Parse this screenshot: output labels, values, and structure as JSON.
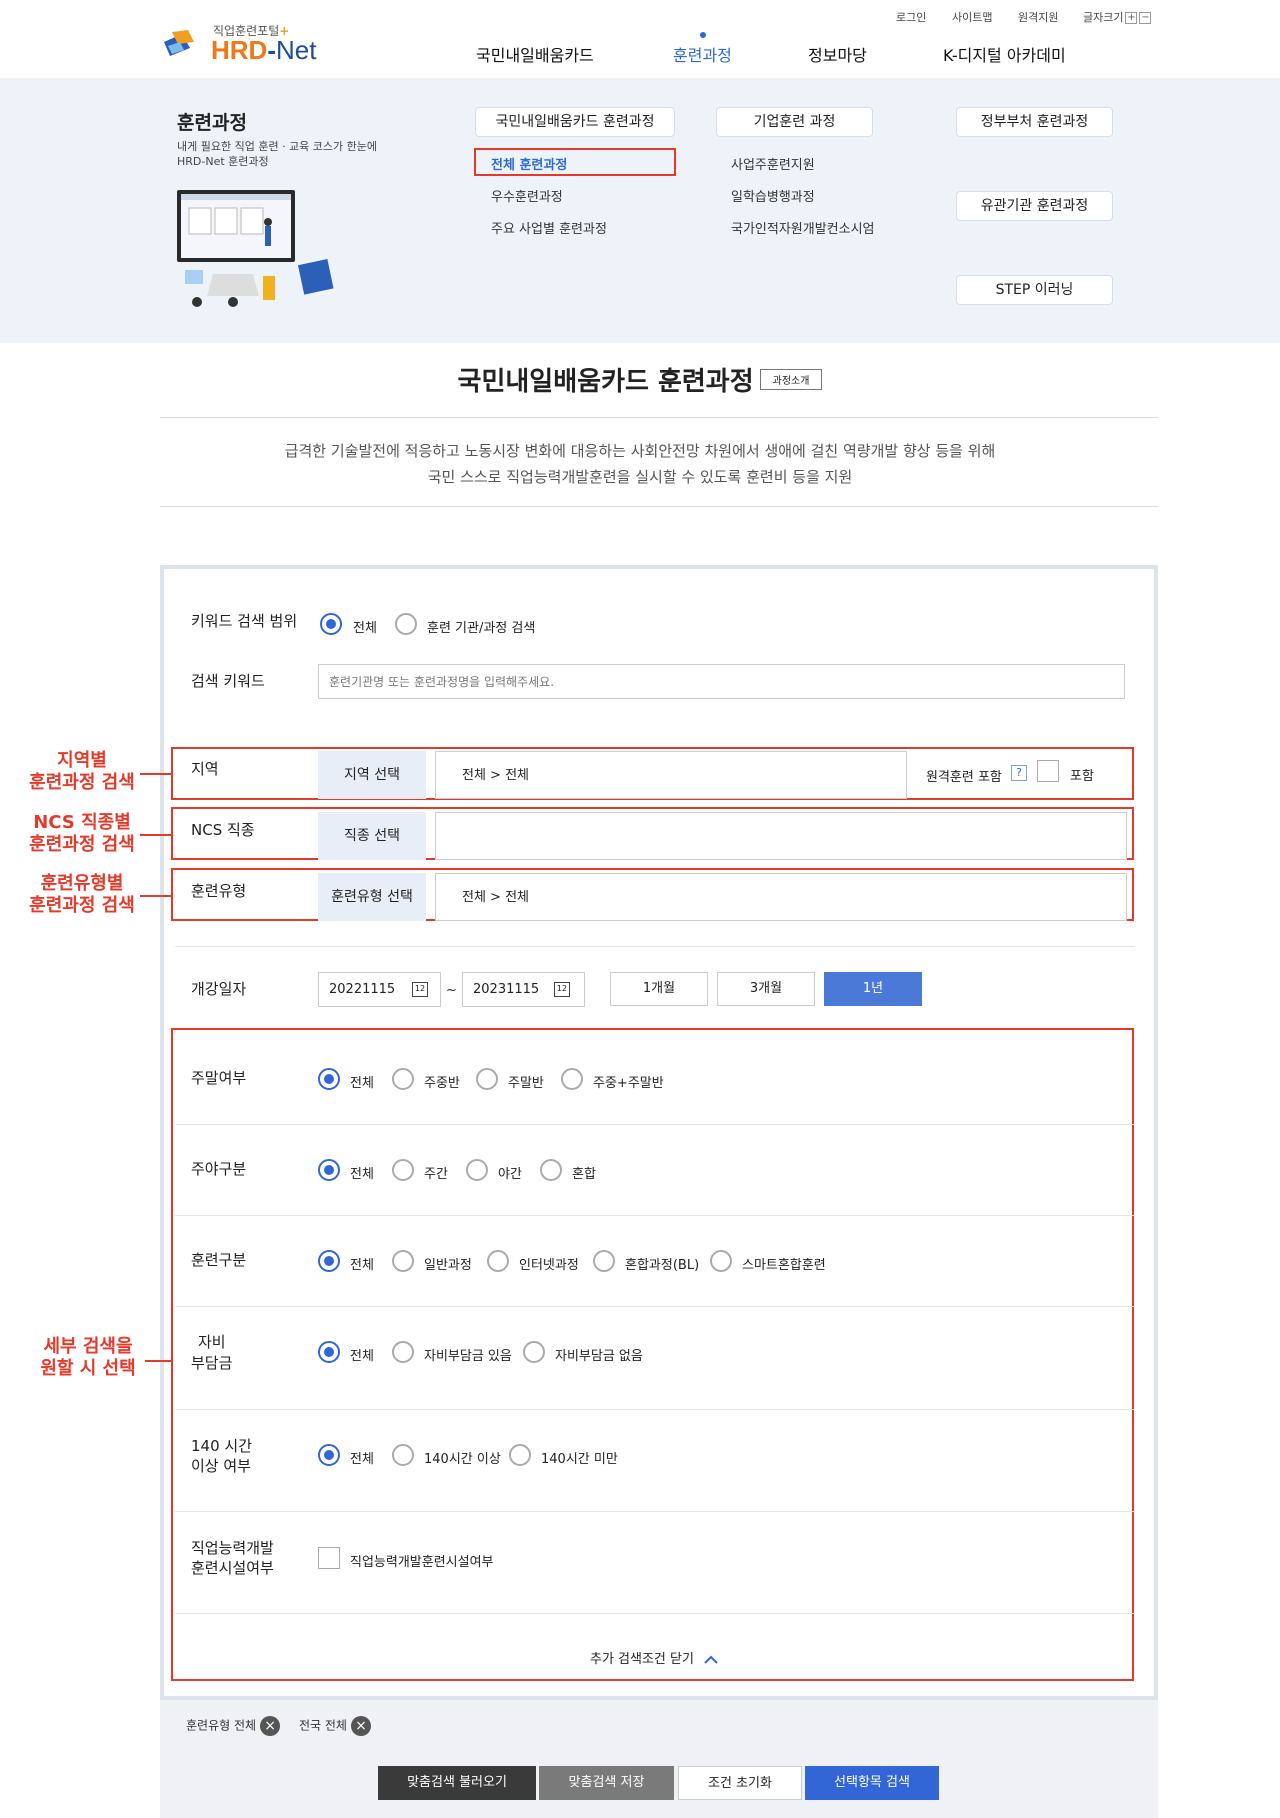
{
  "header": {
    "util": [
      "로그인",
      "사이트맵",
      "원격지원",
      "글자크기"
    ],
    "font_plus": "+",
    "font_minus": "−",
    "logo_sub": "직업훈련포털",
    "logo_plus": "+",
    "logo_hrd": "HRD",
    "logo_dash": "-",
    "logo_net": "Net",
    "gnb": [
      "국민내일배움카드",
      "훈련과정",
      "정보마당",
      "K-디지털 아카데미"
    ]
  },
  "mega": {
    "title": "훈련과정",
    "desc": "내게 필요한 직업 훈련 · 교육 코스가 한눈에 HRD-Net 훈련과정",
    "pills": [
      "국민내일배움카드 훈련과정",
      "기업훈련 과정",
      "정부부처 훈련과정",
      "유관기관 훈련과정",
      "STEP 이러닝"
    ],
    "col1": [
      "전체 훈련과정",
      "우수훈련과정",
      "주요 사업별 훈련과정"
    ],
    "col2": [
      "사업주훈련지원",
      "일학습병행과정",
      "국가인적자원개발컨소시엄"
    ]
  },
  "page": {
    "title": "국민내일배움카드 훈련과정",
    "intro_btn": "과정소개",
    "lead1": "급격한 기술발전에 적응하고 노동시장 변화에 대응하는 사회안전망 차원에서 생애에 걸친 역량개발 향상 등을 위해",
    "lead2": "국민 스스로 직업능력개발훈련을 실시할 수 있도록 훈련비 등을 지원"
  },
  "search": {
    "scope_label": "키워드 검색 범위",
    "scope_opts": [
      "전체",
      "훈련 기관/과정 검색"
    ],
    "keyword_label": "검색 키워드",
    "keyword_placeholder": "훈련기관명 또는 훈련과정명을 입력해주세요.",
    "region_label": "지역",
    "region_btn": "지역 선택",
    "region_value": "전체 > 전체",
    "remote_label": "원격훈련 포함",
    "remote_q": "?",
    "remote_include": "포함",
    "ncs_label": "NCS 직종",
    "ncs_btn": "직종 선택",
    "ncs_value": "",
    "type_label": "훈련유형",
    "type_btn": "훈련유형 선택",
    "type_value": "전체 > 전체",
    "date_label": "개강일자",
    "date_from": "20221115",
    "date_to": "20231115",
    "date_tilde": "~",
    "cal_icon": "12",
    "periods": [
      "1개월",
      "3개월",
      "1년"
    ],
    "weekend_label": "주말여부",
    "weekend_opts": [
      "전체",
      "주중반",
      "주말반",
      "주중+주말반"
    ],
    "daynight_label": "주야구분",
    "daynight_opts": [
      "전체",
      "주간",
      "야간",
      "혼합"
    ],
    "kind_label": "훈련구분",
    "kind_opts": [
      "전체",
      "일반과정",
      "인터넷과정",
      "혼합과정(BL)",
      "스마트혼합훈련"
    ],
    "selfpay_label1": "자비",
    "selfpay_label2": "부담금",
    "selfpay_opts": [
      "전체",
      "자비부담금 있음",
      "자비부담금 없음"
    ],
    "hours_label1": "140 시간",
    "hours_label2": "이상 여부",
    "hours_opts": [
      "전체",
      "140시간 이상",
      "140시간 미만"
    ],
    "facility_label1": "직업능력개발",
    "facility_label2": "훈련시설여부",
    "facility_opt": "직업능력개발훈련시설여부",
    "close_more": "추가 검색조건 닫기"
  },
  "annotations": {
    "a1": [
      "지역별",
      "훈련과정 검색"
    ],
    "a2": [
      "NCS 직종별",
      "훈련과정 검색"
    ],
    "a3": [
      "훈련유형별",
      "훈련과정 검색"
    ],
    "a4": [
      "세부 검색을",
      "원할 시 선택"
    ]
  },
  "bottom": {
    "tags": [
      "훈련유형 전체",
      "전국 전체"
    ],
    "tag_x": "×",
    "buttons": [
      "맞춤검색 불러오기",
      "맞춤검색 저장",
      "조건 초기화",
      "선택항목 검색"
    ]
  },
  "colors": {
    "accent": "#3266d6",
    "annotation": "#e53a2a",
    "orange": "#f07818"
  }
}
